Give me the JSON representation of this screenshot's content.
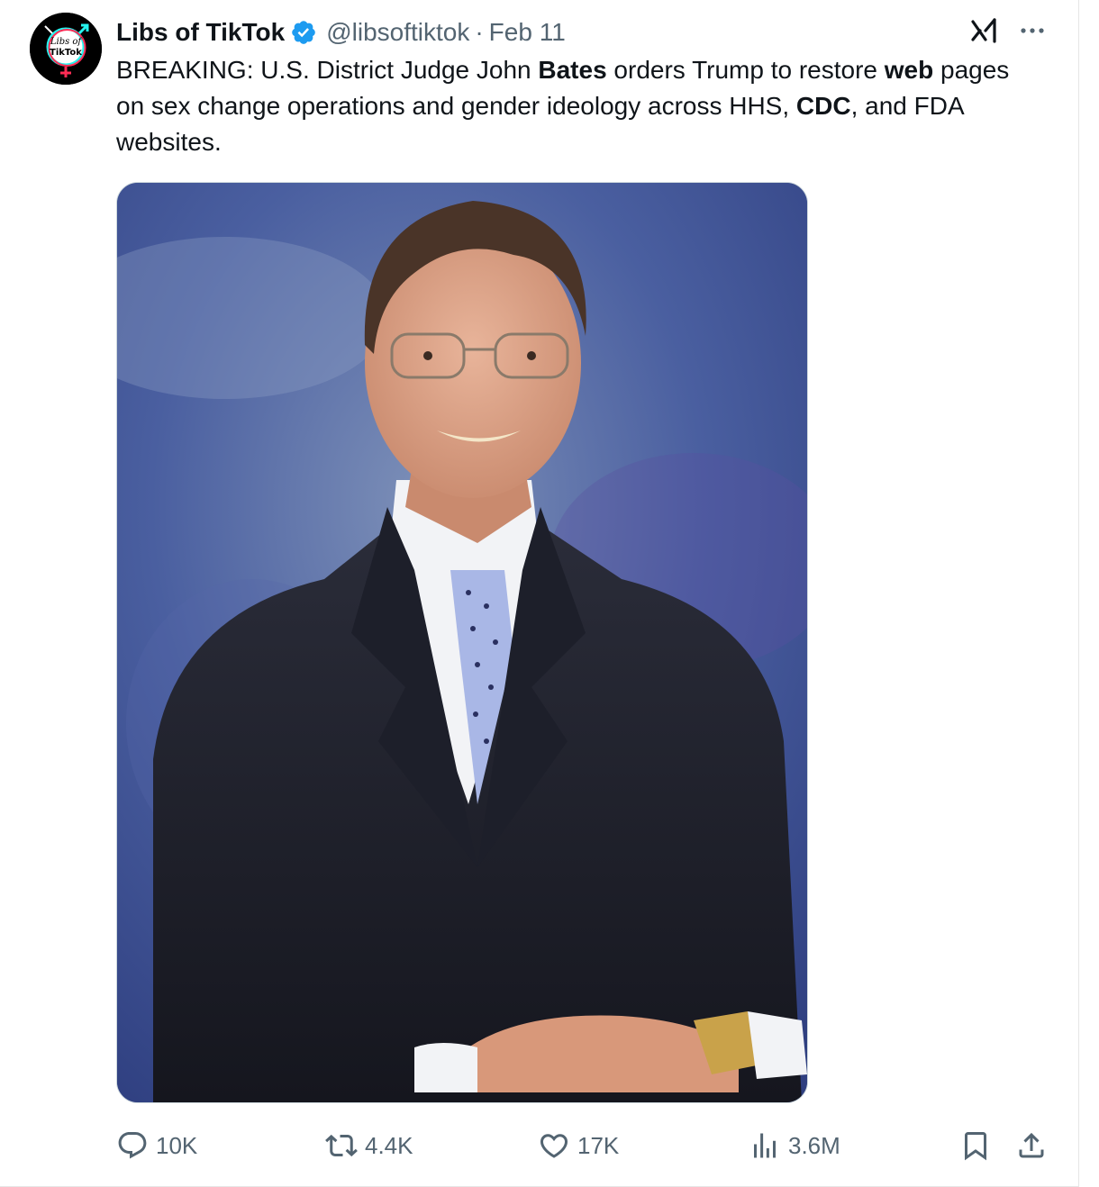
{
  "author": {
    "display_name": "Libs of TikTok",
    "handle": "@libsoftiktok",
    "separator": "·",
    "date": "Feb 11",
    "avatar_text_line1": "Libs of",
    "avatar_text_line2": "TikTok"
  },
  "tweet": {
    "text_parts": [
      {
        "text": "BREAKING: U.S. District Judge John ",
        "bold": false
      },
      {
        "text": "Bates",
        "bold": true
      },
      {
        "text": " orders Trump to restore ",
        "bold": false
      },
      {
        "text": "web",
        "bold": true
      },
      {
        "text": " pages on sex change operations and gender ideology across HHS, ",
        "bold": false
      },
      {
        "text": "CDC",
        "bold": true
      },
      {
        "text": ", and FDA websites.",
        "bold": false
      }
    ]
  },
  "actions": {
    "replies": "10K",
    "reposts": "4.4K",
    "likes": "17K",
    "views": "3.6M"
  },
  "colors": {
    "verified": "#1d9bf0",
    "secondary_text": "#536471",
    "primary_text": "#0f1419"
  },
  "icons": {
    "verified": "verified-badge-icon",
    "grok": "grok-icon",
    "more": "more-icon",
    "reply": "reply-icon",
    "repost": "repost-icon",
    "like": "like-icon",
    "views": "views-icon",
    "bookmark": "bookmark-icon",
    "share": "share-icon"
  }
}
